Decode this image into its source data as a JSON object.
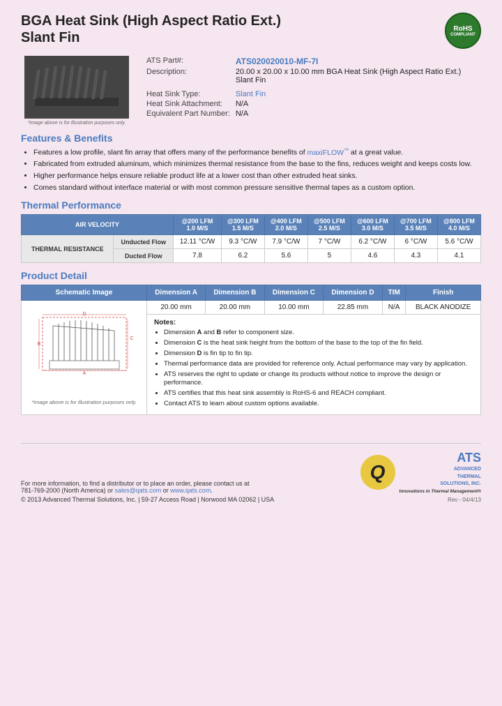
{
  "header": {
    "title_line1": "BGA Heat Sink (High Aspect Ratio Ext.)",
    "title_line2": "Slant Fin",
    "rohs": "RoHS\nCOMPLIANT"
  },
  "specs": {
    "part_label": "ATS Part#:",
    "part_number": "ATS020020010-MF-7I",
    "description_label": "Description:",
    "description": "20.00 x 20.00 x 10.00 mm BGA Heat Sink (High Aspect Ratio Ext.) Slant Fin",
    "type_label": "Heat Sink Type:",
    "type_value": "Slant Fin",
    "attachment_label": "Heat Sink Attachment:",
    "attachment_value": "N/A",
    "equiv_label": "Equivalent Part Number:",
    "equiv_value": "N/A"
  },
  "image_note": "*Image above is for illustration purposes only.",
  "sections": {
    "features_heading": "Features & Benefits",
    "thermal_heading": "Thermal Performance",
    "detail_heading": "Product Detail"
  },
  "features": [
    "Features a low profile, slant fin array that offers many of the performance benefits of maxiFLOW™ at a great value.",
    "Fabricated from extruded aluminum, which minimizes thermal resistance from the base to the fins, reduces weight and keeps costs low.",
    "Higher performance helps ensure reliable product life at a lower cost than other extruded heat sinks.",
    "Comes standard without interface material or with most common pressure sensitive thermal tapes as a custom option."
  ],
  "thermal_table": {
    "col_air_velocity": "AIR VELOCITY",
    "columns": [
      {
        "lfm": "@200 LFM",
        "ms": "1.0 M/S"
      },
      {
        "lfm": "@300 LFM",
        "ms": "1.5 M/S"
      },
      {
        "lfm": "@400 LFM",
        "ms": "2.0 M/S"
      },
      {
        "lfm": "@500 LFM",
        "ms": "2.5 M/S"
      },
      {
        "lfm": "@600 LFM",
        "ms": "3.0 M/S"
      },
      {
        "lfm": "@700 LFM",
        "ms": "3.5 M/S"
      },
      {
        "lfm": "@800 LFM",
        "ms": "4.0 M/S"
      }
    ],
    "row_header": "THERMAL RESISTANCE",
    "rows": [
      {
        "label": "Unducted Flow",
        "values": [
          "12.11 °C/W",
          "9.3 °C/W",
          "7.9 °C/W",
          "7 °C/W",
          "6.2 °C/W",
          "6 °C/W",
          "5.6 °C/W"
        ]
      },
      {
        "label": "Ducted Flow",
        "values": [
          "7.8",
          "6.2",
          "5.6",
          "5",
          "4.6",
          "4.3",
          "4.1"
        ]
      }
    ]
  },
  "product_detail": {
    "columns": [
      "Schematic Image",
      "Dimension A",
      "Dimension B",
      "Dimension C",
      "Dimension D",
      "TIM",
      "Finish"
    ],
    "dim_a": "20.00 mm",
    "dim_b": "20.00 mm",
    "dim_c": "10.00 mm",
    "dim_d": "22.85 mm",
    "tim": "N/A",
    "finish": "BLACK ANODIZE",
    "schematic_note": "*Image above is for illustration purposes only.",
    "notes_label": "Notes:",
    "notes": [
      "Dimension A and B refer to component size.",
      "Dimension C is the heat sink height from the bottom of the base to the top of the fin field.",
      "Dimension D is fin tip to fin tip.",
      "Thermal performance data are provided for reference only. Actual performance may vary by application.",
      "ATS reserves the right to update or change its products without notice to improve the design or performance.",
      "ATS certifies that this heat sink assembly is RoHS-6 and REACH compliant.",
      "Contact ATS to learn about custom options available."
    ]
  },
  "footer": {
    "contact_text": "For more information, to find a distributor or to place an order, please contact us at",
    "phone": "781-769-2000 (North America)",
    "email": "sales@qats.com",
    "or": "or",
    "website": "www.qats.com",
    "copyright": "© 2013 Advanced Thermal Solutions, Inc.  |  59-27 Access Road  |  Norwood MA  02062  |  USA",
    "rev": "Rev - 04/4/13",
    "ats_tagline": "ADVANCED\nTHERMAL\nSOLUTIONS, INC.",
    "ats_sub": "Innovations in Thermal Management®"
  }
}
